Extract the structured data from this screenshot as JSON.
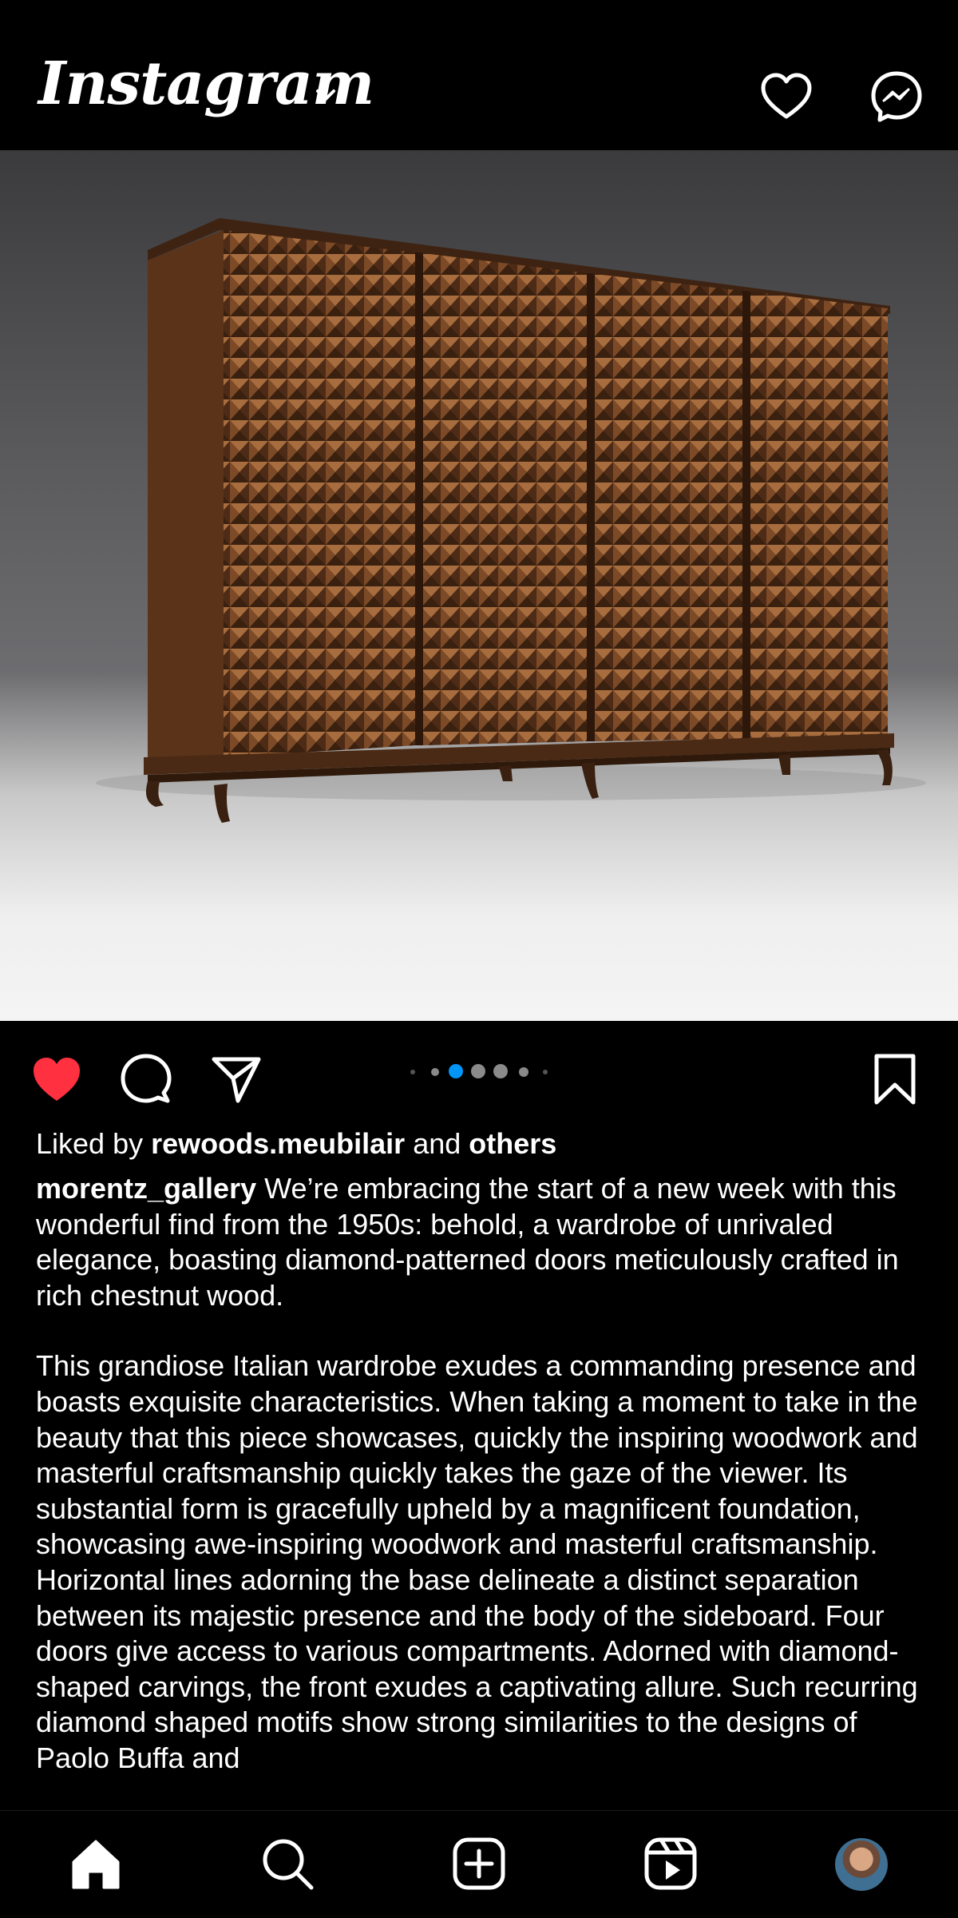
{
  "header": {
    "logo_text": "Instagram",
    "icons": [
      "chevron-down-icon",
      "heart-icon",
      "messenger-icon"
    ]
  },
  "post": {
    "carousel": {
      "total": 7,
      "active_index": 2
    },
    "liked_by_prefix": "Liked by",
    "liked_by_user": "rewoods.meubilair",
    "liked_by_and": "and",
    "liked_by_others": "others",
    "author": "morentz_gallery",
    "caption_p1": "We’re embracing the start of a new week with this wonderful find from the 1950s: behold, a wardrobe of unrivaled elegance, boasting diamond-patterned doors meticulously crafted in rich chestnut wood.",
    "caption_p2": "This grandiose Italian wardrobe exudes a commanding presence and boasts exquisite characteristics. When taking a moment to take in the beauty that this piece showcases, quickly the inspiring woodwork and masterful craftsmanship quickly takes the gaze of the viewer. Its substantial form is gracefully upheld by a magnificent foundation, showcasing awe-inspiring woodwork and masterful craftsmanship. Horizontal lines adorning the base delineate a distinct separation between its majestic presence and the body of the sideboard. Four doors give access to various compartments. Adorned with diamond-shaped carvings, the front exudes a captivating allure. Such recurring diamond shaped motifs show strong similarities to the designs of Paolo Buffa and"
  },
  "colors": {
    "like_active": "#ff3040",
    "dot_active": "#0095f6",
    "background": "#000000"
  },
  "nav": {
    "icons": [
      "home-icon",
      "search-icon",
      "create-icon",
      "reels-icon",
      "profile-avatar"
    ]
  }
}
